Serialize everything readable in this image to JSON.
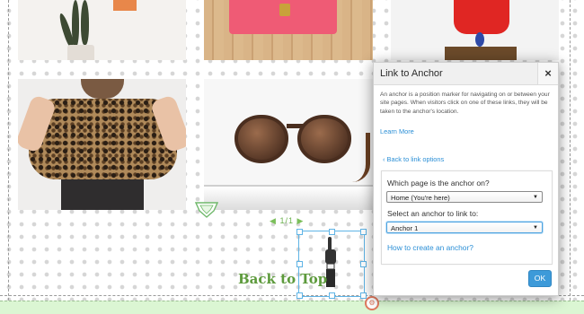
{
  "gallery": {
    "pager": {
      "prev_icon": "triangle-left",
      "label": "1/1",
      "next_icon": "triangle-right"
    }
  },
  "section": {
    "back_to_top": "Back to Top",
    "accent_color": "#5d9a3c"
  },
  "dialog": {
    "title": "Link to Anchor",
    "close_label": "×",
    "description": "An anchor is a position marker for navigating on or between your site pages. When visitors click on one of these links, they will be taken to the anchor's location.",
    "learn_more": "Learn More",
    "back_link": "Back to link options",
    "page_question": "Which page is the anchor on?",
    "page_select_value": "Home (You're here)",
    "anchor_question": "Select an anchor to link to:",
    "anchor_select_value": "Anchor 1",
    "how_to_link": "How to create an anchor?",
    "ok_label": "OK",
    "link_color": "#2b8fd6",
    "button_color": "#3d9ad9"
  }
}
